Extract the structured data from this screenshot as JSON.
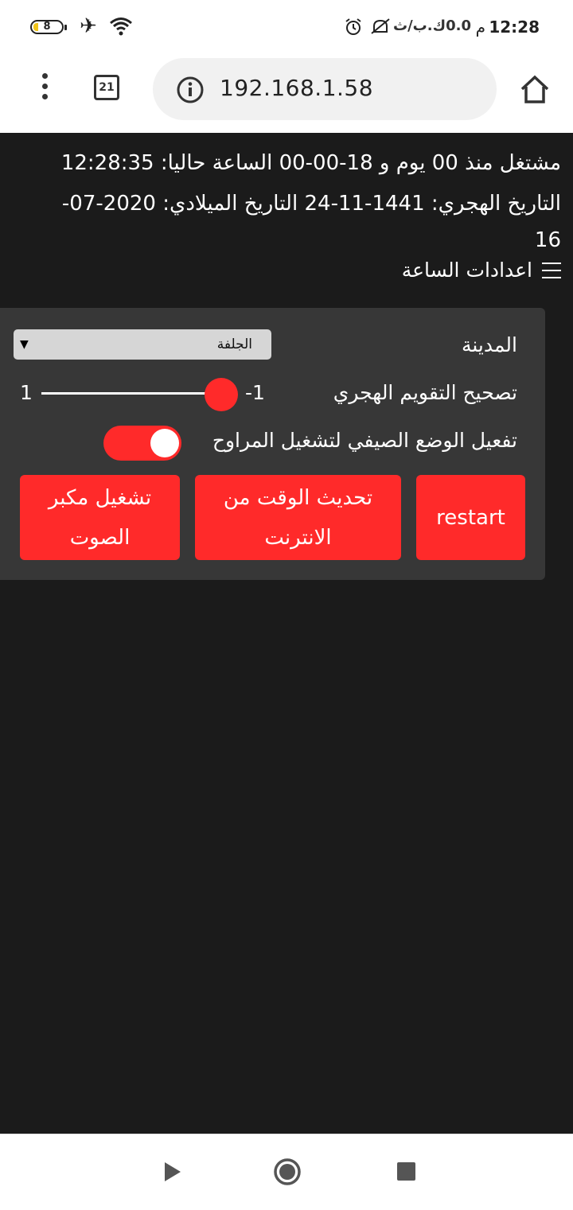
{
  "status_bar": {
    "time": "12:28",
    "am_pm": "م",
    "data_speed": "0.0ك.ب/ث",
    "battery": "8",
    "icons": [
      "battery-icon",
      "airplane-icon",
      "wifi-icon",
      "alarm-icon",
      "mute-icon"
    ]
  },
  "browser": {
    "tab_count": "21",
    "url": "192.168.1.58"
  },
  "page": {
    "uptime_line": "مشتغل منذ 00 يوم و 18-00-00 الساعة حاليا: 12:28:35",
    "dates_line": "التاريخ الهجري: 1441-11-24 التاريخ الميلادي: 2020-07-16",
    "settings_label": "اعدادات الساعة",
    "city_label": "المدينة",
    "city_value": "الجلفة",
    "hijri_label": "تصحيح التقويم الهجري",
    "hijri_value": "-1",
    "hijri_max": "1",
    "summer_label": "تفعيل الوضع الصيفي لتشغيل المراوح",
    "summer_on": true,
    "buttons": {
      "restart": "restart",
      "update_time": "تحديث الوقت من الانترنت",
      "speaker": "تشغيل مكبر الصوت"
    },
    "accent_color": "#ff2a2a"
  }
}
